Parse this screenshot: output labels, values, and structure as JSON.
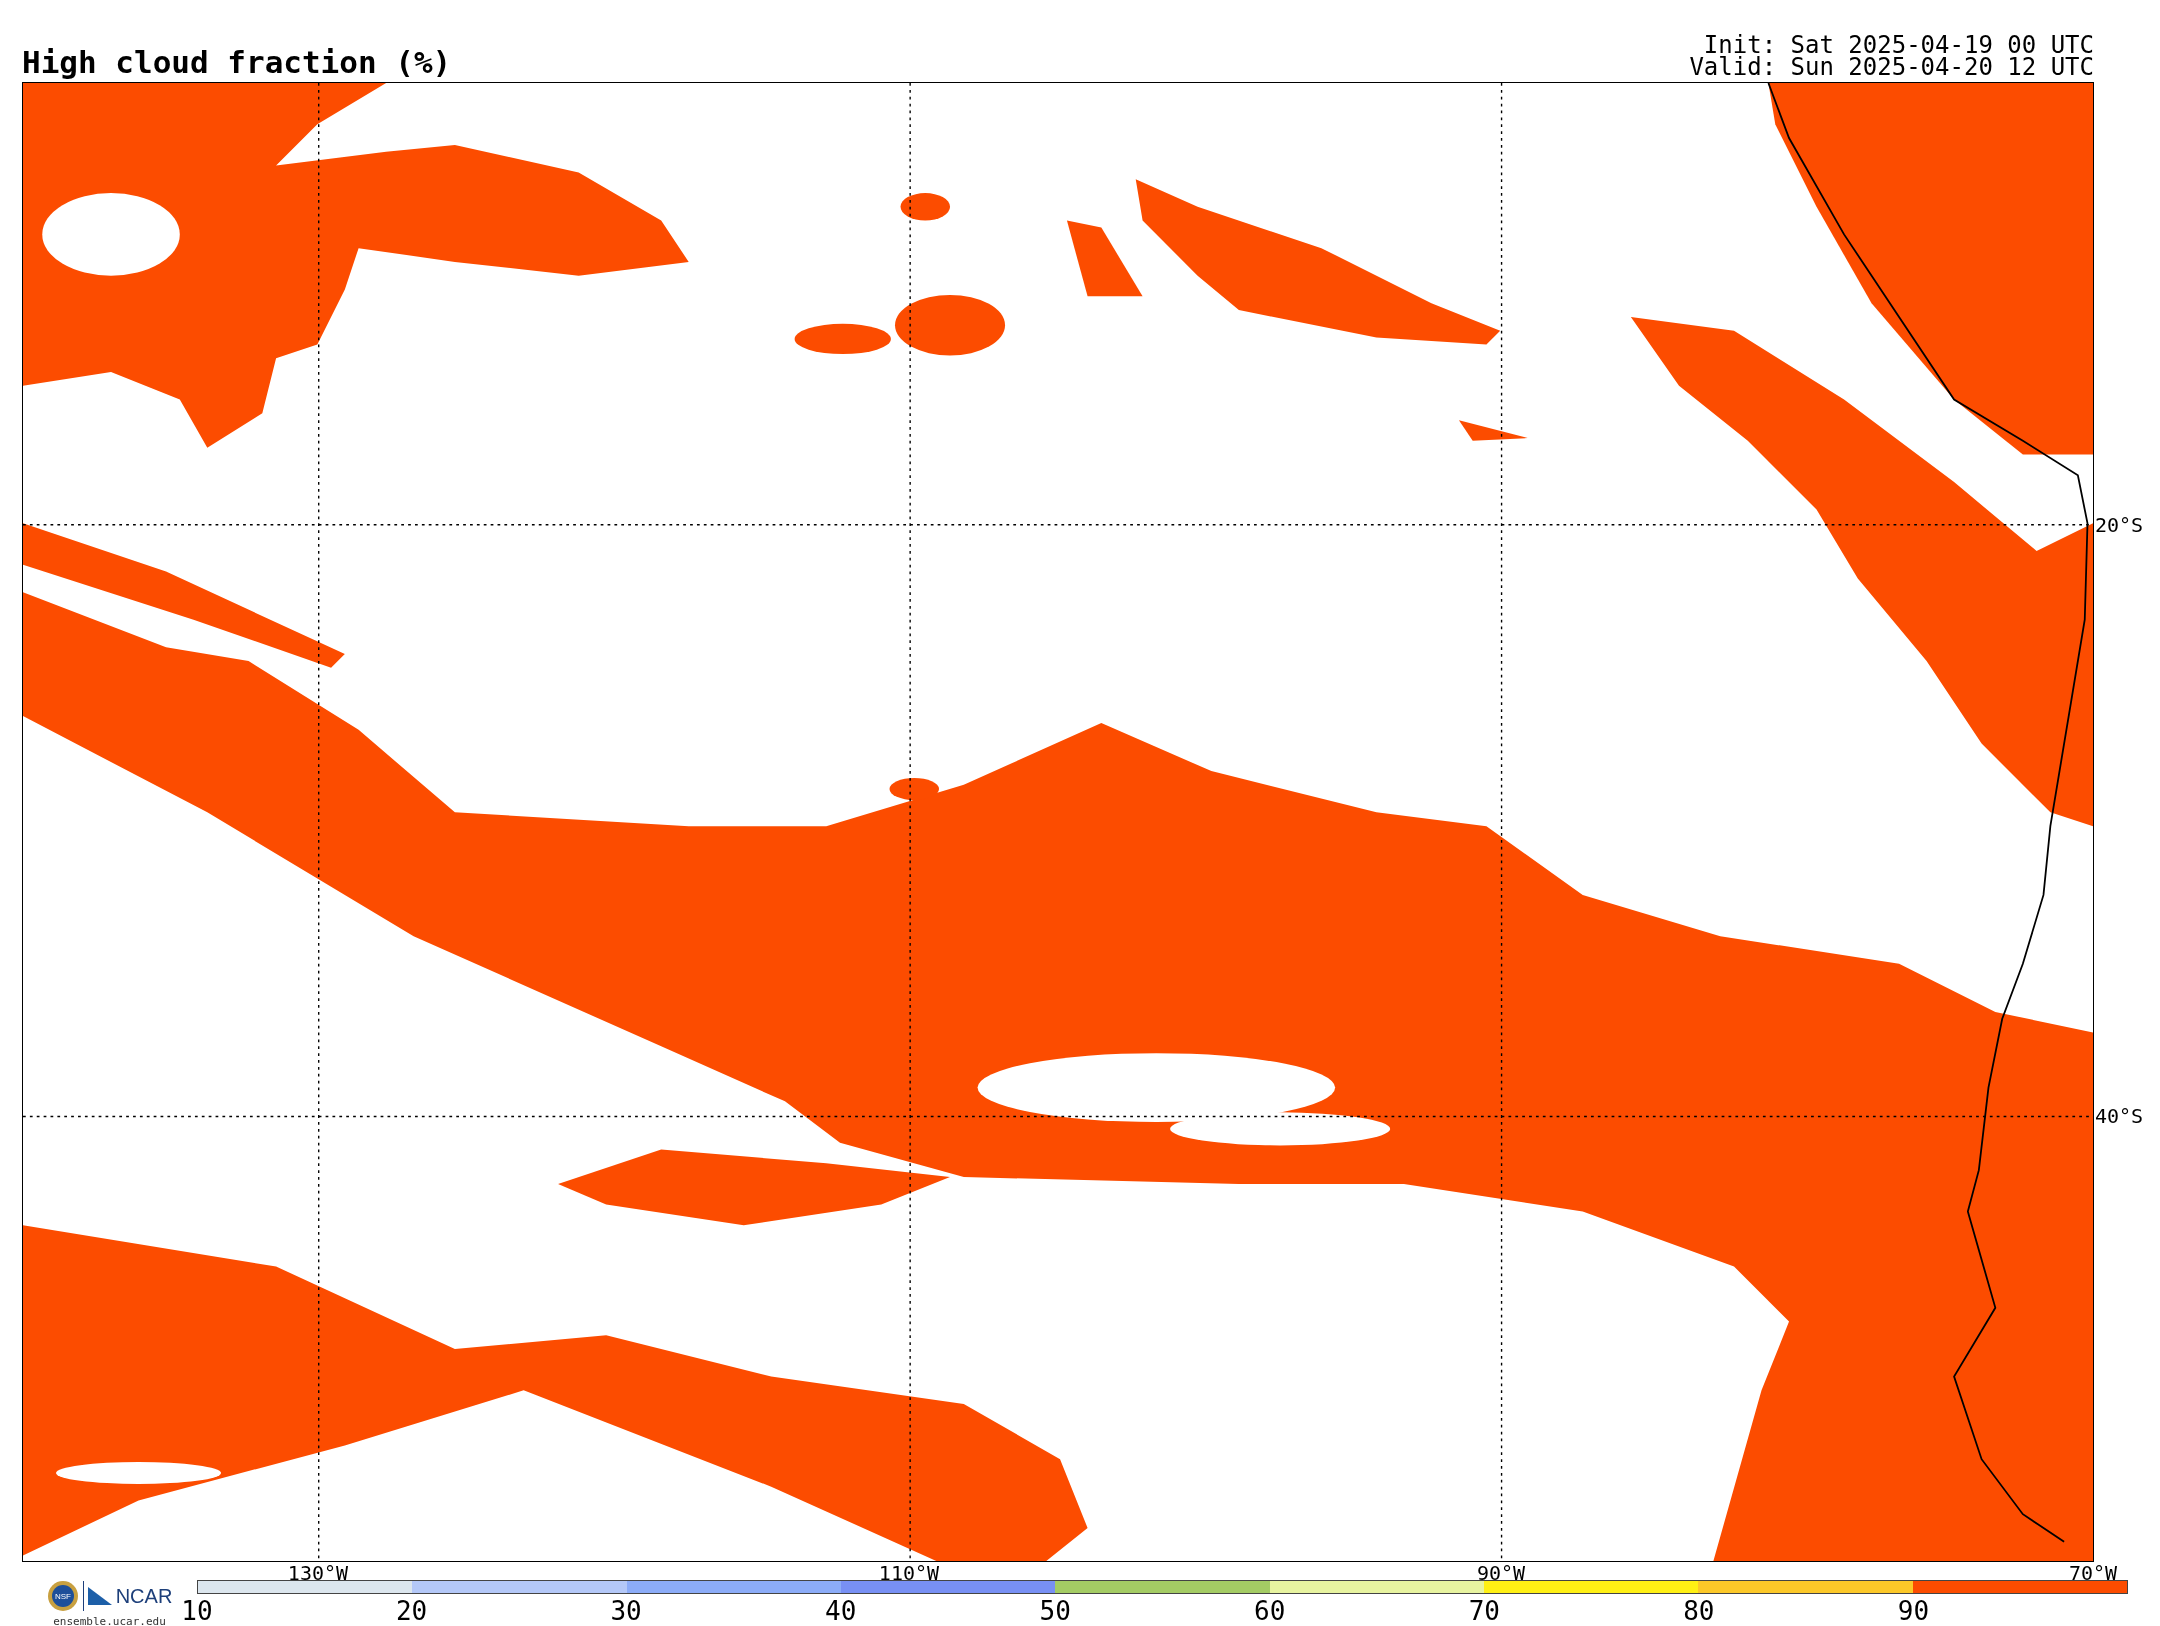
{
  "title": "High cloud fraction (%)",
  "init": "Init: Sat 2025-04-19 00 UTC",
  "valid": "Valid: Sun 2025-04-20 12 UTC",
  "lon_labels": [
    "130°W",
    "110°W",
    "90°W",
    "70°W"
  ],
  "lat_labels": [
    "20°S",
    "40°S"
  ],
  "logo": {
    "seal": "NSF",
    "name": "NCAR",
    "site": "ensemble.ucar.edu"
  },
  "colorbar": {
    "ticks": [
      "10",
      "20",
      "30",
      "40",
      "50",
      "60",
      "70",
      "80",
      "90"
    ],
    "segments": [
      {
        "color": "#dce6ee"
      },
      {
        "color": "#b4c8f8"
      },
      {
        "color": "#8cacf8"
      },
      {
        "color": "#7890f4"
      },
      {
        "color": "#a4cc64"
      },
      {
        "color": "#e8f4a0"
      },
      {
        "color": "#fff014"
      },
      {
        "color": "#fcc828"
      },
      {
        "color": "#fc4c00"
      }
    ]
  }
}
